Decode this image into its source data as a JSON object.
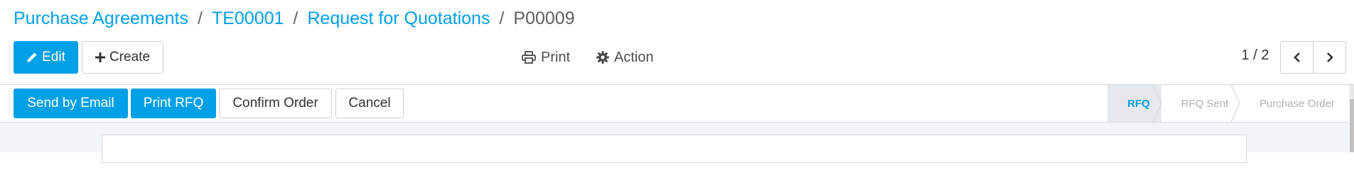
{
  "breadcrumb": {
    "items": [
      "Purchase Agreements",
      "TE00001",
      "Request for Quotations"
    ],
    "current": "P00009",
    "separator": "/"
  },
  "buttons": {
    "edit": {
      "label": "Edit",
      "icon": "pencil-icon"
    },
    "create": {
      "label": "Create",
      "icon": "plus-icon"
    }
  },
  "sidebar": {
    "print": {
      "label": "Print",
      "icon": "printer-icon"
    },
    "action": {
      "label": "Action",
      "icon": "gear-icon"
    }
  },
  "pager": {
    "value": "1 / 2"
  },
  "header_buttons": {
    "send_email": "Send by Email",
    "print_rfq": "Print RFQ",
    "confirm_order": "Confirm Order",
    "cancel": "Cancel"
  },
  "statusbar": {
    "stages": [
      "RFQ",
      "RFQ Sent",
      "Purchase Order"
    ],
    "active": "RFQ"
  },
  "colors": {
    "accent": "#00a0e6",
    "stage_active_bg": "#e6e9ec",
    "content_bg": "#f2f5f8"
  }
}
